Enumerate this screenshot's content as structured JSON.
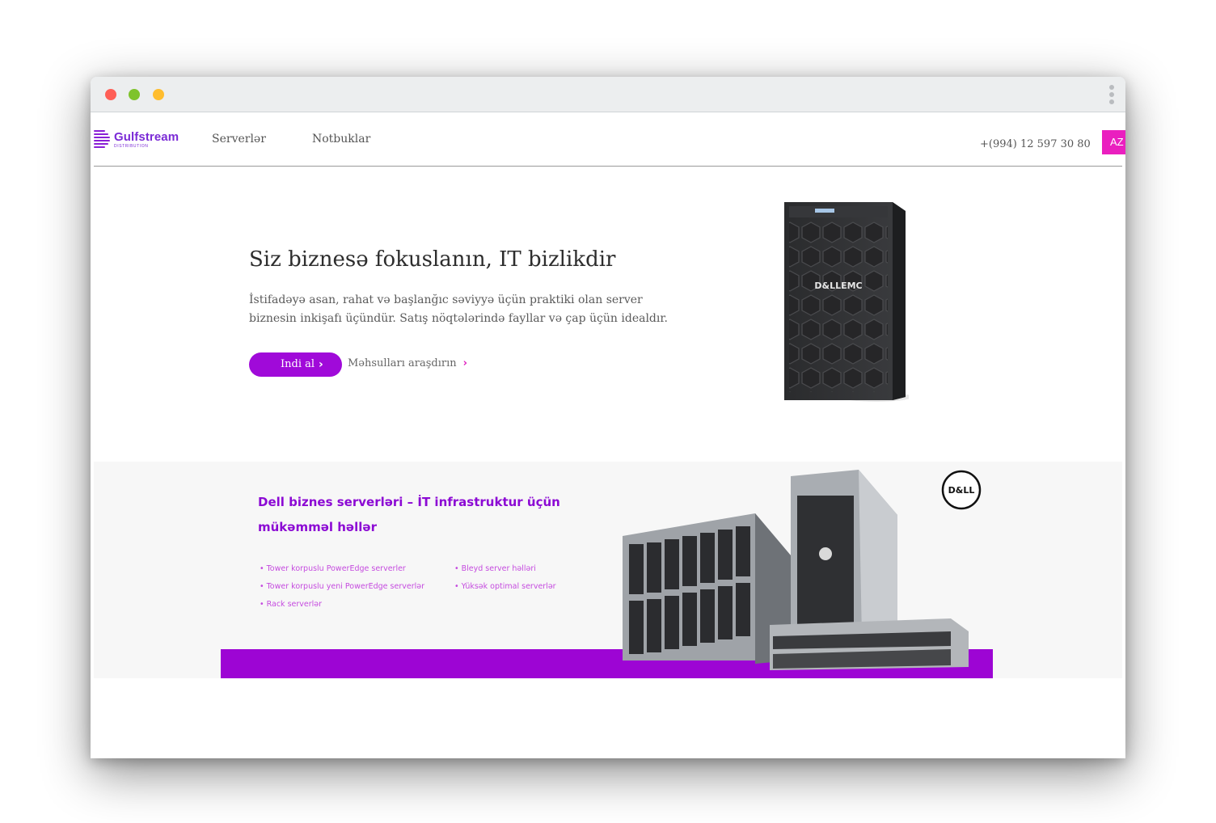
{
  "browser": {
    "controls": [
      "close",
      "minimize",
      "maximize"
    ],
    "menu_icon": "kebab-menu-icon"
  },
  "nav": {
    "logo": {
      "name": "Gulfstream",
      "sub": "DISTRIBUTION"
    },
    "links": [
      "Serverlər",
      "Notbuklar"
    ],
    "phone": "+(994) 12 597 30 80",
    "lang": "AZ"
  },
  "hero": {
    "title": "Siz biznesə fokuslanın, IT bizlikdir",
    "description": "İstifadəyə asan, rahat və başlanğıc səviyyə üçün praktiki olan server biznesin inkişafı üçündür. Satış nöqtələrində fayllar və çap üçün idealdır.",
    "buy_label": "Indi al",
    "explore_label": "Məhsulları araşdırın",
    "product_logo": "D&LLEMC"
  },
  "banner": {
    "title": "Dell biznes serverləri – İT infrastruktur üçün mükəmməl həllər",
    "features_left": [
      "• Tower korpuslu PowerEdge serverler",
      "• Tower korpuslu yeni PowerEdge serverlər",
      "• Rack serverlər"
    ],
    "features_right": [
      "• Bleyd server həlləri",
      "• Yüksək optimal serverlər"
    ],
    "brand": "D&LL"
  },
  "colors": {
    "brand_purple": "#a00ad9",
    "accent_pink": "#ea1fbf",
    "bar_purple": "#9d05d4"
  }
}
